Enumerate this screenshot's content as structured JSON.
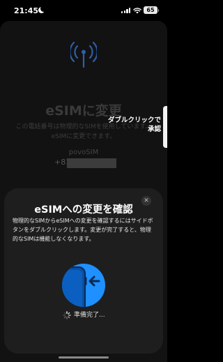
{
  "status_bar": {
    "time": "21:45",
    "battery": "65"
  },
  "background": {
    "title": "eSIMに変更",
    "description": "この電話番号は物理的なSIMを使用しています。eSIMに変更できます。",
    "carrier": "povoSIM",
    "number_prefix": "+81"
  },
  "side_hint": {
    "line1": "ダブルクリックで",
    "line2": "承認"
  },
  "modal": {
    "close_glyph": "✕",
    "title": "eSIMへの変更を確認",
    "description": "物理的なSIMからeSIMへの変更を確認するにはサイドボタンをダブルクリックします。変更が完了すると、物理的なSIMは機能しなくなります。",
    "progress": "準備完了..."
  },
  "colors": {
    "accent_blue": "#1e90ff",
    "modal_bg": "#1e1e1e"
  }
}
